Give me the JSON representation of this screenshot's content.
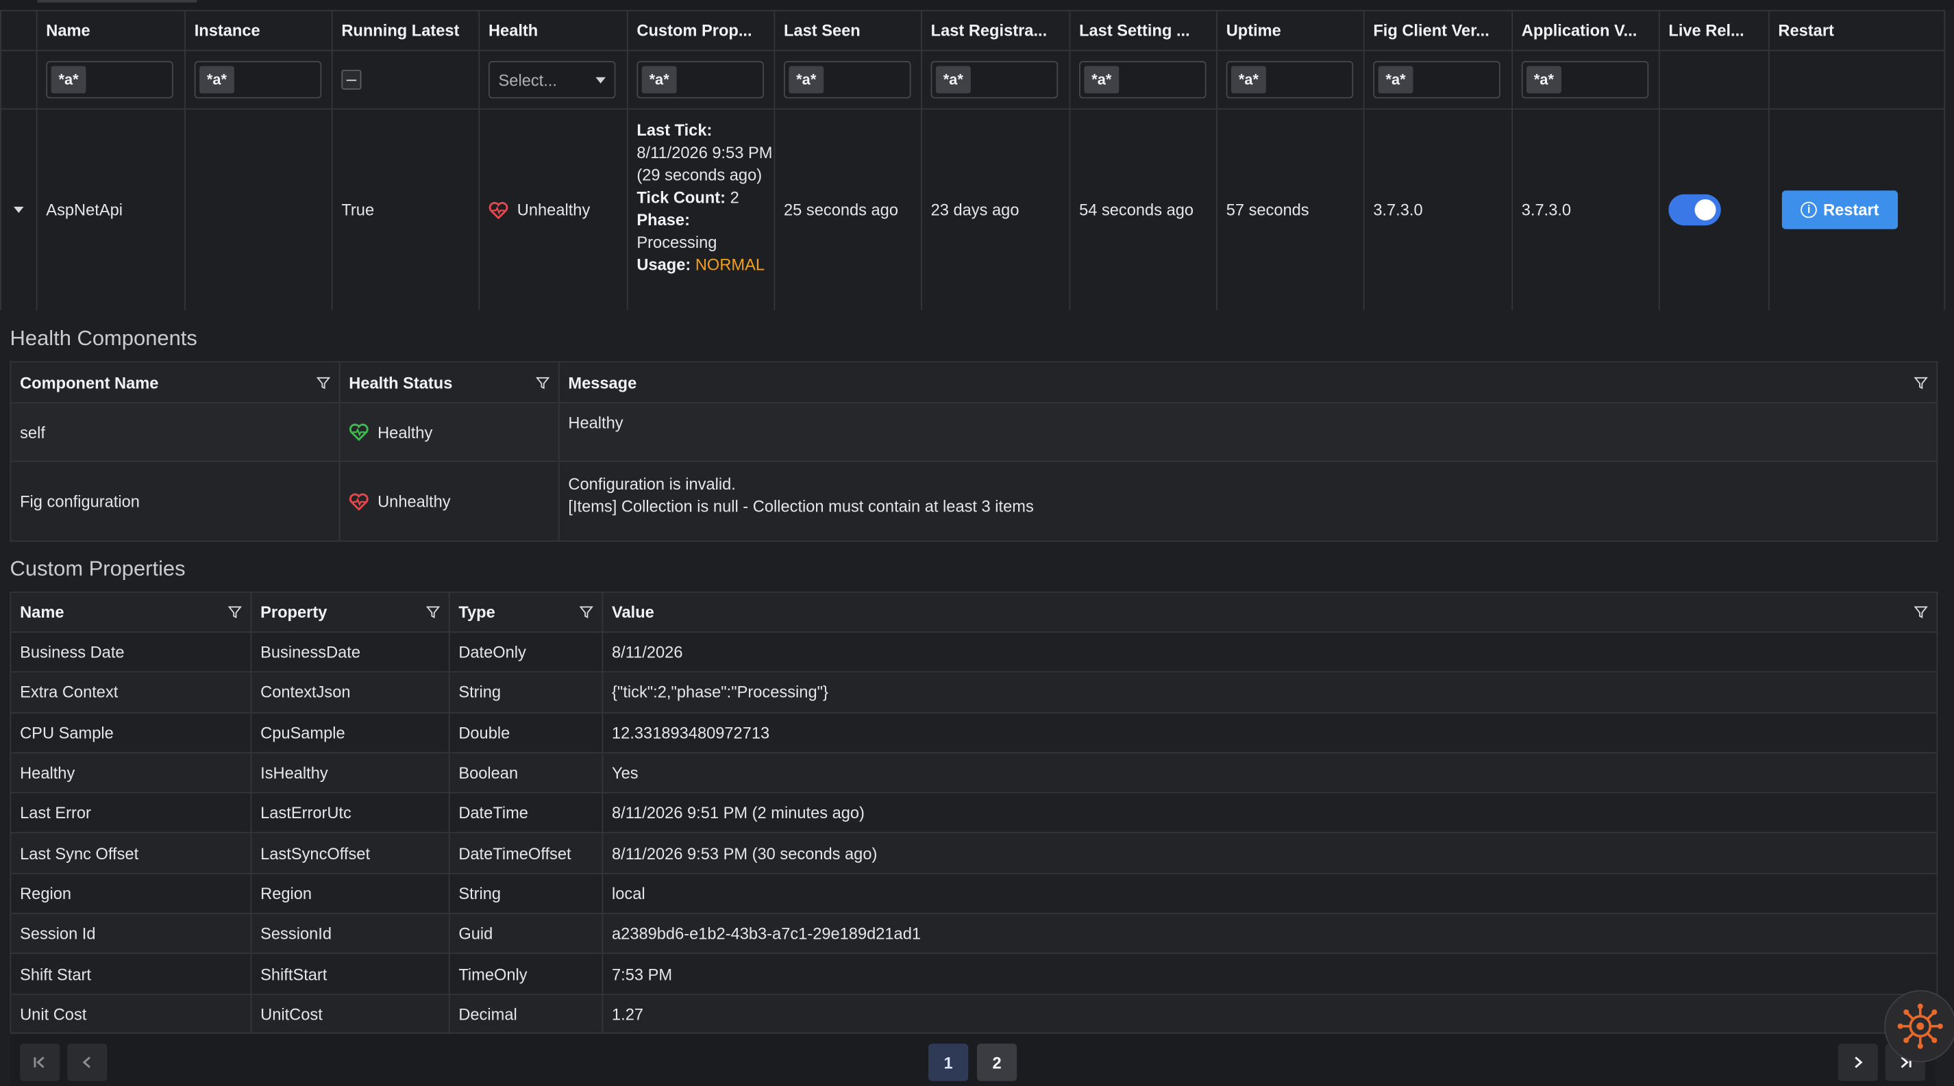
{
  "main_table": {
    "columns": [
      "Name",
      "Instance",
      "Running Latest",
      "Health",
      "Custom Prop...",
      "Last Seen",
      "Last Registra...",
      "Last Setting ...",
      "Uptime",
      "Fig Client Ver...",
      "Application V...",
      "Live Rel...",
      "Restart"
    ],
    "filter_badge": "*a*",
    "health_select_placeholder": "Select...",
    "row": {
      "name": "AspNetApi",
      "instance": "",
      "running_latest": "True",
      "health": "Unhealthy",
      "custom": {
        "last_tick_label": "Last Tick:",
        "last_tick_value": "8/11/2026 9:53 PM (29 seconds ago)",
        "tick_count_label": "Tick Count:",
        "tick_count_value": "2",
        "phase_label": "Phase:",
        "phase_value": "Processing",
        "usage_label": "Usage:",
        "usage_value": "NORMAL"
      },
      "last_seen": "25 seconds ago",
      "last_registration": "23 days ago",
      "last_setting": "54 seconds ago",
      "uptime": "57 seconds",
      "fig_client_version": "3.7.3.0",
      "application_version": "3.7.3.0",
      "live_reload": true,
      "restart_label": "Restart"
    }
  },
  "health_components": {
    "title": "Health Components",
    "columns": [
      "Component Name",
      "Health Status",
      "Message"
    ],
    "rows": [
      {
        "name": "self",
        "status": "Healthy",
        "message_line1": "Healthy",
        "message_line2": ""
      },
      {
        "name": "Fig configuration",
        "status": "Unhealthy",
        "message_line1": "Configuration is invalid.",
        "message_line2": "[Items] Collection is null - Collection must contain at least 3 items"
      }
    ]
  },
  "custom_properties": {
    "title": "Custom Properties",
    "columns": [
      "Name",
      "Property",
      "Type",
      "Value"
    ],
    "rows": [
      {
        "name": "Business Date",
        "property": "BusinessDate",
        "type": "DateOnly",
        "value": "8/11/2026"
      },
      {
        "name": "Extra Context",
        "property": "ContextJson",
        "type": "String",
        "value": "{\"tick\":2,\"phase\":\"Processing\"}"
      },
      {
        "name": "CPU Sample",
        "property": "CpuSample",
        "type": "Double",
        "value": "12.331893480972713"
      },
      {
        "name": "Healthy",
        "property": "IsHealthy",
        "type": "Boolean",
        "value": "Yes"
      },
      {
        "name": "Last Error",
        "property": "LastErrorUtc",
        "type": "DateTime",
        "value": "8/11/2026 9:51 PM (2 minutes ago)"
      },
      {
        "name": "Last Sync Offset",
        "property": "LastSyncOffset",
        "type": "DateTimeOffset",
        "value": "8/11/2026 9:53 PM (30 seconds ago)"
      },
      {
        "name": "Region",
        "property": "Region",
        "type": "String",
        "value": "local"
      },
      {
        "name": "Session Id",
        "property": "SessionId",
        "type": "Guid",
        "value": "a2389bd6-e1b2-43b3-a7c1-29e189d21ad1"
      },
      {
        "name": "Shift Start",
        "property": "ShiftStart",
        "type": "TimeOnly",
        "value": "7:53 PM"
      },
      {
        "name": "Unit Cost",
        "property": "UnitCost",
        "type": "Decimal",
        "value": "1.27"
      }
    ]
  },
  "pager": {
    "pages": [
      "1",
      "2"
    ],
    "current": "1"
  },
  "colors": {
    "healthy": "#3fb950",
    "unhealthy": "#e5484d",
    "accent": "#3c8fea",
    "usage": "#f0a020"
  }
}
